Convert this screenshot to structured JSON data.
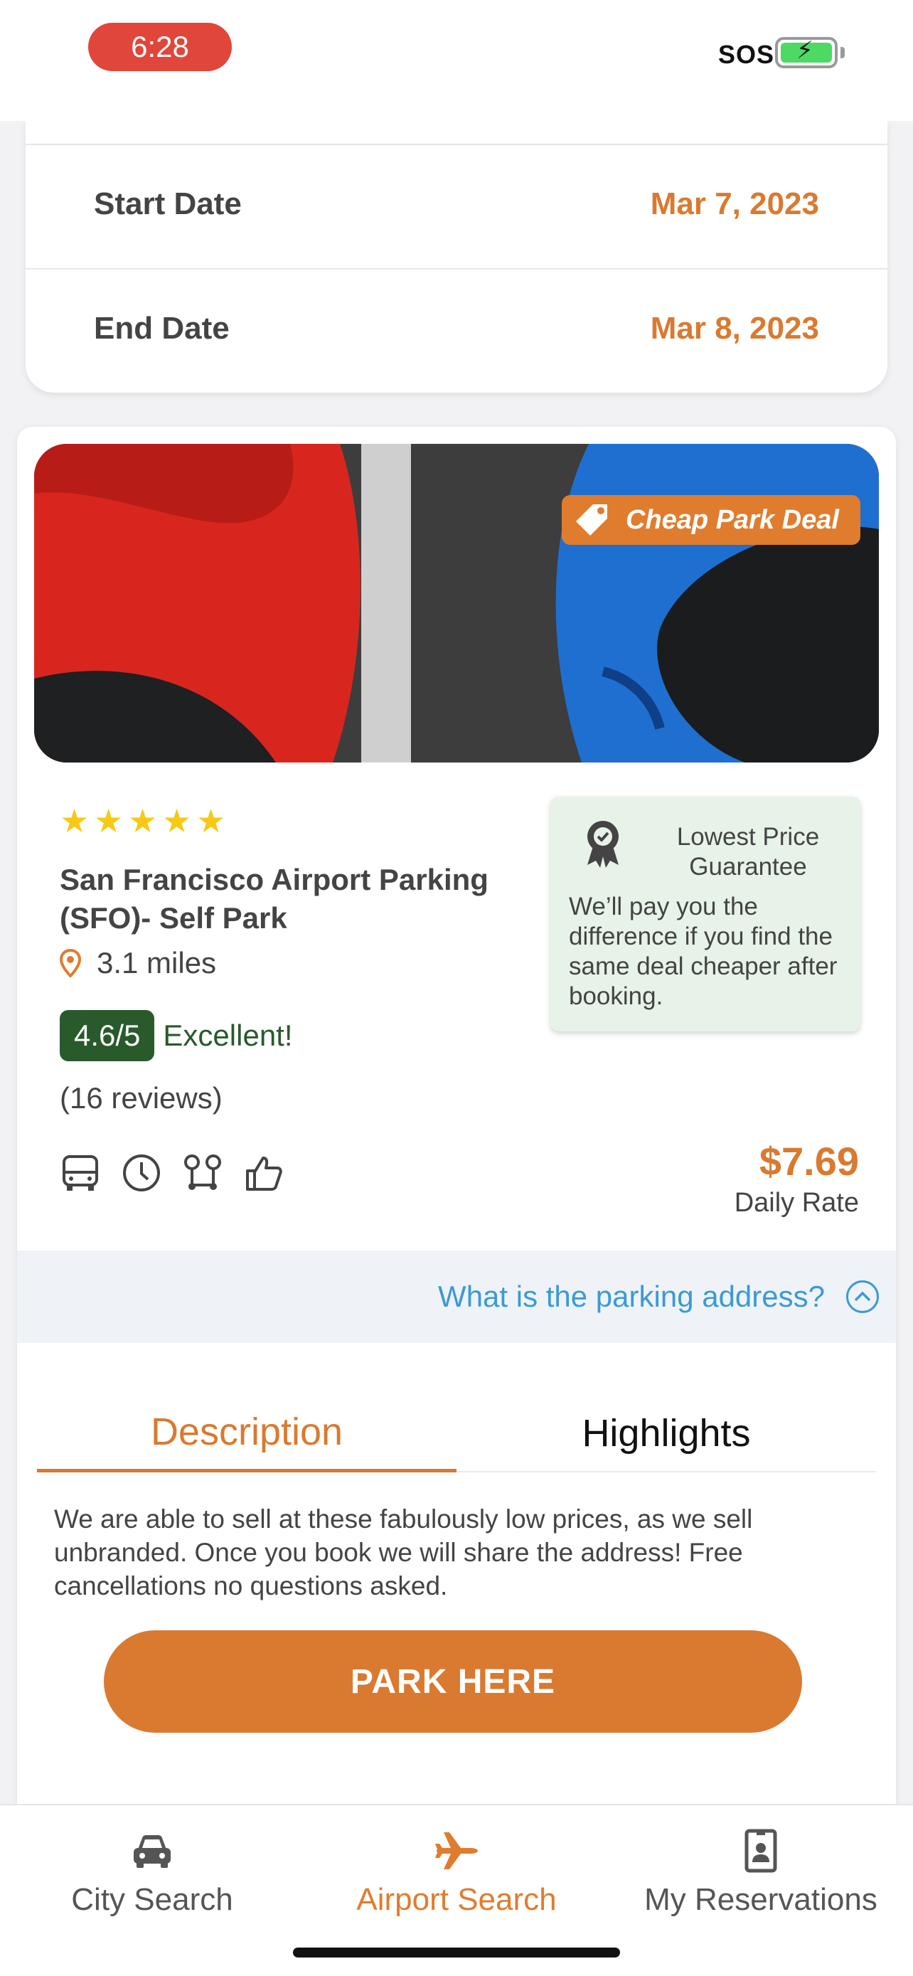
{
  "status_bar": {
    "time": "6:28",
    "carrier": "SOS"
  },
  "dates": {
    "start_label": "Start Date",
    "start_value": "Mar 7, 2023",
    "end_label": "End Date",
    "end_value": "Mar 8, 2023"
  },
  "lot": {
    "deal_tag": "Cheap Park Deal",
    "stars": 5,
    "name": "San Francisco Airport Parking (SFO)- Self Park",
    "distance": "3.1 miles",
    "rating_score": "4.6/5",
    "rating_word": "Excellent!",
    "reviews": "(16 reviews)",
    "amenity_icons": [
      "bus-icon",
      "clock-icon",
      "route-icon",
      "thumbs-up-icon"
    ],
    "guarantee_title": "Lowest Price Guarantee",
    "guarantee_body": "We’ll pay you the difference if you find the same deal cheaper after booking.",
    "price": "$7.69",
    "price_label": "Daily Rate",
    "address_question": "What is the parking address?"
  },
  "tabs": {
    "description": "Description",
    "highlights": "Highlights"
  },
  "description_text": "We are able to sell at these fabulously low prices, as we sell unbranded. Once you book we will share the address! Free cancellations no questions asked.",
  "cta": "PARK HERE",
  "bottom_nav": {
    "city": "City Search",
    "airport": "Airport Search",
    "reservations": "My Reservations"
  },
  "colors": {
    "accent": "#d97a30",
    "rating_green": "#285a2c",
    "link_blue": "#3b9ad4",
    "star_yellow": "#f6c915"
  }
}
